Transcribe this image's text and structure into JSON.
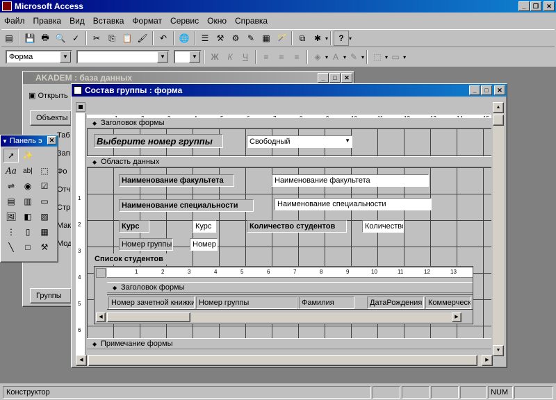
{
  "app": {
    "title": "Microsoft Access"
  },
  "menu": [
    "Файл",
    "Правка",
    "Вид",
    "Вставка",
    "Формат",
    "Сервис",
    "Окно",
    "Справка"
  ],
  "format_bar": {
    "object_combo": "Форма",
    "bold": "Ж",
    "italic": "К",
    "underline": "Ч"
  },
  "db_window": {
    "title": "AKADEM : база данных",
    "open_button": "Открыть",
    "objects_button": "Объекты",
    "items": [
      "Таб",
      "Зап",
      "Фо",
      "Отч",
      "Стр",
      "Мак",
      "Мод"
    ],
    "groups_button": "Группы"
  },
  "toolbox": {
    "title": "Панель э",
    "tools": [
      "Aa",
      "ab|"
    ]
  },
  "form_window": {
    "title": "Состав группы : форма",
    "ruler": [
      "1",
      "2",
      "3",
      "4",
      "5",
      "6",
      "7",
      "8",
      "9",
      "10",
      "11",
      "12",
      "13",
      "14",
      "15"
    ],
    "vruler": [
      "1",
      "2",
      "3",
      "4",
      "5",
      "6"
    ],
    "header_section": "Заголовок формы",
    "select_label": "Выберите номер группы",
    "select_value": "Свободный",
    "detail_section": "Область данных",
    "fields": [
      {
        "label": "Наименование факультета",
        "value": "Наименование факультета"
      },
      {
        "label": "Наименование специальности",
        "value": "Наименование специальности"
      },
      {
        "label": "Курс",
        "value": "Курс"
      },
      {
        "label": "Количество студентов",
        "value": "Количество"
      },
      {
        "label": "Номер группы",
        "value": "Номер"
      }
    ],
    "subform_label": "Список студентов",
    "subform": {
      "ruler": [
        "1",
        "2",
        "3",
        "4",
        "5",
        "6",
        "7",
        "8",
        "9",
        "10",
        "11",
        "12",
        "13"
      ],
      "header_section": "Заголовок формы",
      "columns": [
        "Номер зачетной книжки",
        "Номер группы",
        "Фамилия",
        "ДатаРождения",
        "Коммерческий"
      ]
    },
    "footer_section": "Примечание формы"
  },
  "status": {
    "text": "Конструктор",
    "num": "NUM"
  }
}
